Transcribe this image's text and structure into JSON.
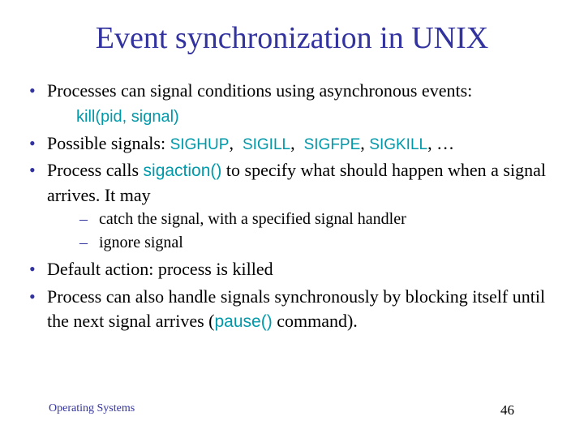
{
  "title": "Event synchronization in UNIX",
  "bullets": {
    "b1": "Processes can signal conditions using asynchronous events:",
    "code_line": "kill(pid, signal)",
    "b2_prefix": "Possible signals: ",
    "sig1": "SIGHUP",
    "sig2": "SIGILL",
    "sig3": "SIGFPE",
    "sig4": "SIGKILL",
    "b2_suffix": ", …",
    "b3_prefix": "Process calls ",
    "b3_code": "sigaction()",
    "b3_suffix": " to specify what should happen when a signal arrives.  It may",
    "sub1": "catch the signal, with a specified signal handler",
    "sub2": "ignore signal",
    "b4": "Default action: process is killed",
    "b5_prefix": "Process can also handle signals synchronously by blocking itself  until the next signal arrives (",
    "b5_code": "pause()",
    "b5_suffix": " command)."
  },
  "footer": {
    "left": "Operating Systems",
    "page": "46"
  }
}
